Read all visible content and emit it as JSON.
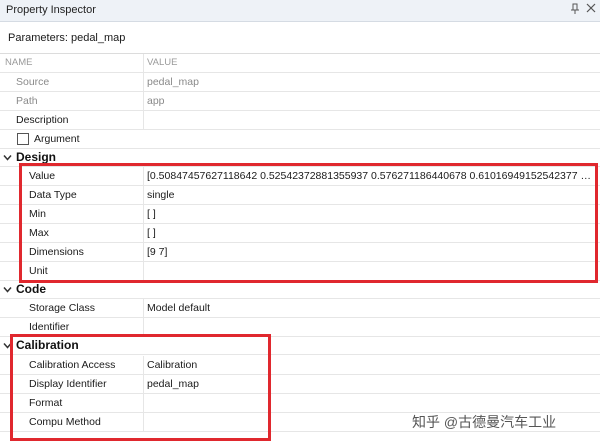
{
  "window": {
    "title": "Property Inspector"
  },
  "parameters_label": "Parameters: pedal_map",
  "columns": {
    "name": "NAME",
    "value": "VALUE"
  },
  "general": [
    {
      "name": "Source",
      "value": "pedal_map"
    },
    {
      "name": "Path",
      "value": "app"
    },
    {
      "name": "Description",
      "value": ""
    }
  ],
  "argument": {
    "label": "Argument",
    "checked": false
  },
  "design": {
    "title": "Design",
    "rows": [
      {
        "name": "Value",
        "value": "[0.50847457627118642 0.52542372881355937 0.576271186440678 0.61016949152542377 0.6..."
      },
      {
        "name": "Data Type",
        "value": "single"
      },
      {
        "name": "Min",
        "value": "[ ]"
      },
      {
        "name": "Max",
        "value": "[ ]"
      },
      {
        "name": "Dimensions",
        "value": "[9 7]"
      },
      {
        "name": "Unit",
        "value": ""
      }
    ]
  },
  "code": {
    "title": "Code",
    "rows": [
      {
        "name": "Storage Class",
        "value": "Model default"
      },
      {
        "name": "Identifier",
        "value": ""
      }
    ]
  },
  "calibration": {
    "title": "Calibration",
    "rows": [
      {
        "name": "Calibration Access",
        "value": "Calibration"
      },
      {
        "name": "Display Identifier",
        "value": "pedal_map"
      },
      {
        "name": "Format",
        "value": ""
      },
      {
        "name": "Compu Method",
        "value": ""
      }
    ]
  },
  "watermark": "知乎 @古德曼汽车工业",
  "colors": {
    "highlight": "#e0282e",
    "titlebar": "#eef2f7"
  }
}
